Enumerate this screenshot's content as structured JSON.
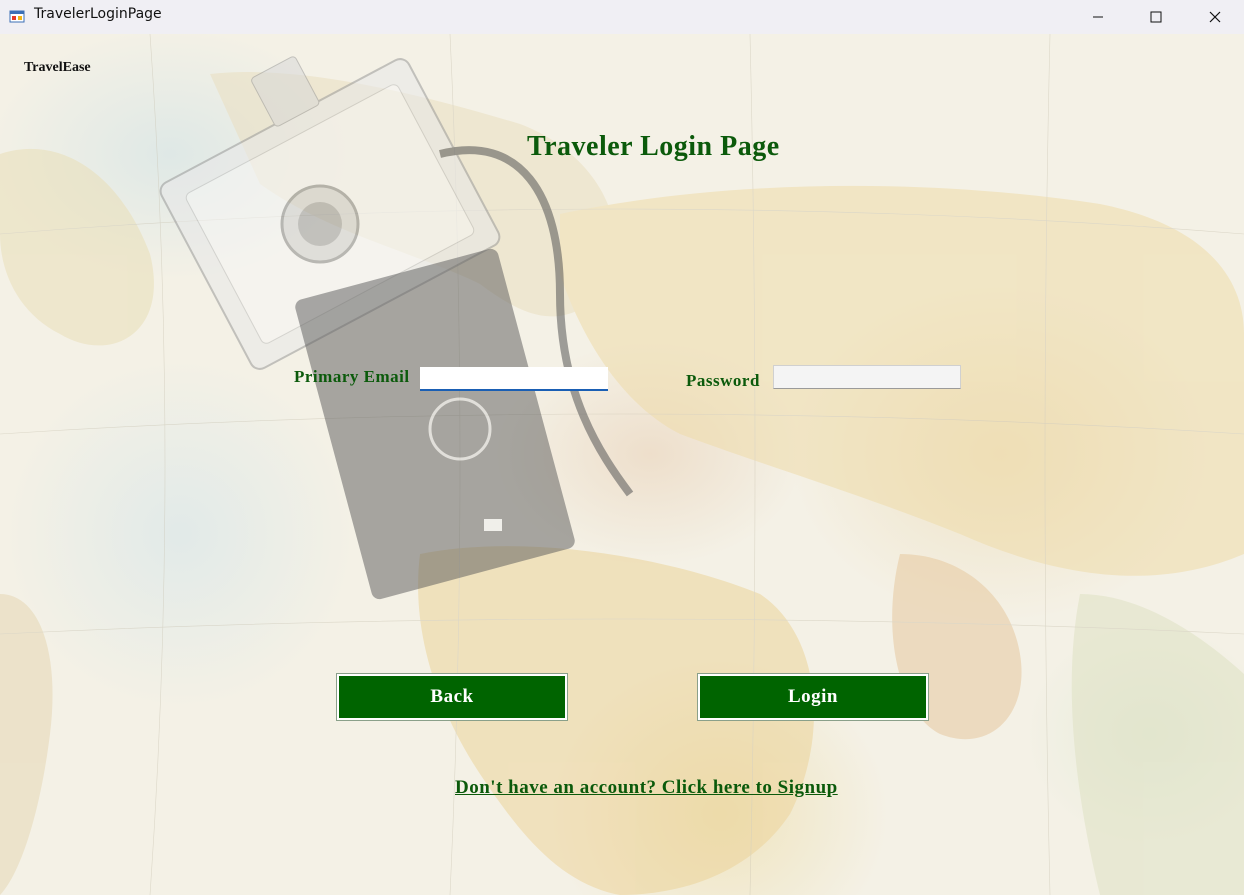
{
  "window": {
    "title": "TravelerLoginPage"
  },
  "app": {
    "brand": "TravelEase",
    "page_title": "Traveler Login Page"
  },
  "form": {
    "email_label": "Primary Email",
    "email_value": "",
    "password_label": "Password",
    "password_value": ""
  },
  "buttons": {
    "back_label": "Back",
    "login_label": "Login"
  },
  "links": {
    "signup_text": "Don't have an account? Click here to Signup"
  },
  "colors": {
    "accent_green": "#006400",
    "label_green": "#0b5a0b",
    "focus_blue": "#1a5fb4"
  }
}
